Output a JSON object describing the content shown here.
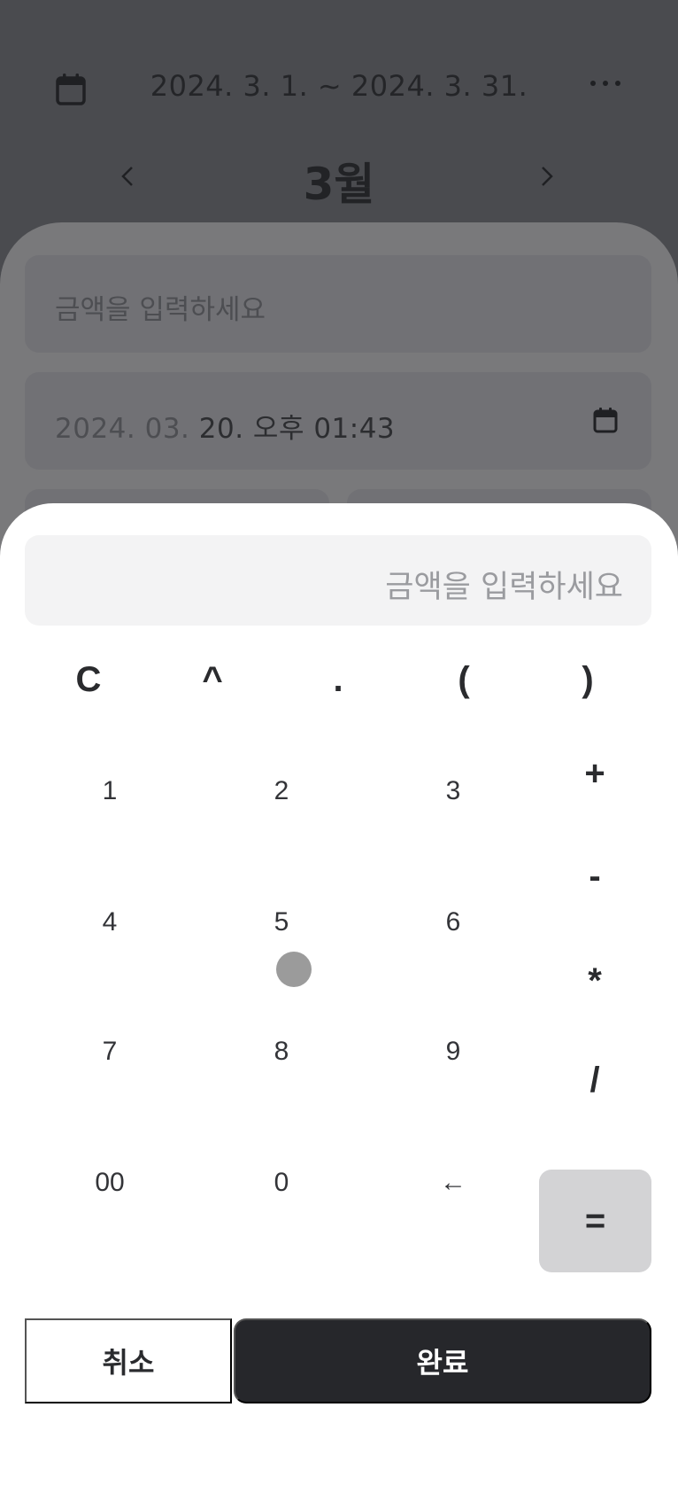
{
  "header": {
    "date_range": "2024. 3. 1. ~ 2024. 3. 31.",
    "month": "3월"
  },
  "background_form": {
    "amount_placeholder": "금액을 입력하세요",
    "datetime_date_faded": "2024. 03. ",
    "datetime_rest": "20. 오후 01:43"
  },
  "calculator": {
    "display_placeholder": "금액을 입력하세요",
    "function_keys": [
      "C",
      "^",
      ".",
      "(",
      ")"
    ],
    "number_rows": [
      [
        "1",
        "2",
        "3"
      ],
      [
        "4",
        "5",
        "6"
      ],
      [
        "7",
        "8",
        "9"
      ],
      [
        "00",
        "0",
        "←"
      ]
    ],
    "operators": [
      "+",
      "-",
      "*",
      "/"
    ],
    "equals": "=",
    "cancel_label": "취소",
    "done_label": "완료"
  },
  "colors": {
    "overlay_bg": "#4a4b4f",
    "sheet_bg": "#ffffff",
    "primary_button": "#26272b",
    "equals_button": "#d3d3d5"
  }
}
